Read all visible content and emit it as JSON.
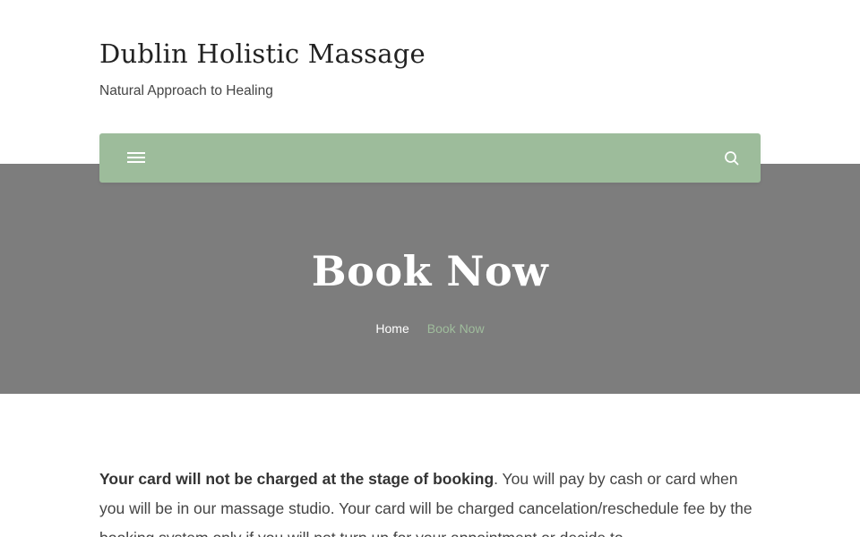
{
  "site": {
    "title": "Dublin Holistic Massage",
    "tagline": "Natural Approach to Healing"
  },
  "navbar": {
    "menu_icon": "hamburger-menu-icon",
    "search_icon": "search-icon",
    "color": "#9dbc9b"
  },
  "hero": {
    "title": "Book Now",
    "background_color": "#7d7d7d",
    "breadcrumb": {
      "home": "Home",
      "current": "Book Now",
      "current_color": "#9fbc9c"
    }
  },
  "content": {
    "bold_lead": "Your card will not be charged at the stage of booking",
    "rest": ". You will pay by cash or card when you will be in our massage studio. Your card will be charged cancelation/reschedule fee by the booking system only if you will not turn up for your appointment or decide to"
  }
}
